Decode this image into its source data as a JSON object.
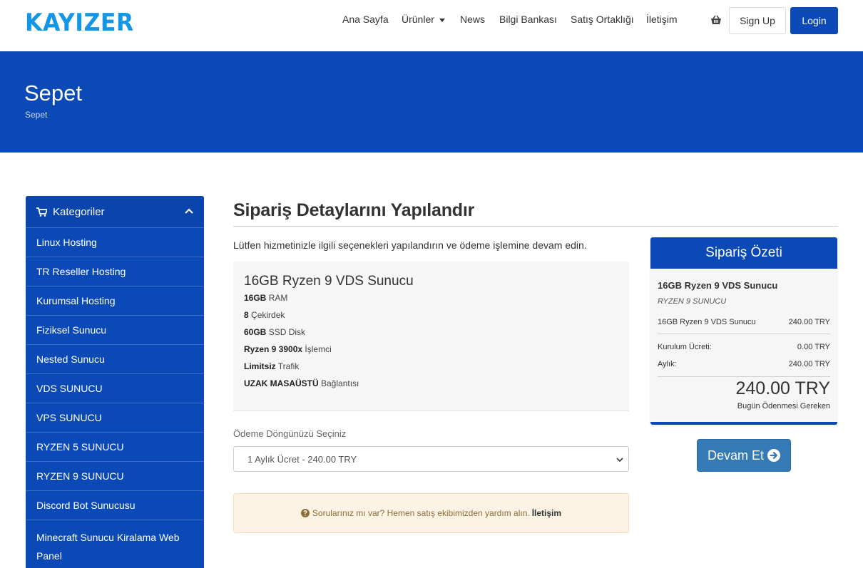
{
  "brand": {
    "logo": "KAYIZER"
  },
  "nav": {
    "items": [
      "Ana Sayfa",
      "Ürünler",
      "News",
      "Bilgi Bankası",
      "Satış Ortaklığı",
      "İletişim"
    ],
    "signup": "Sign Up",
    "login": "Login"
  },
  "hero": {
    "title": "Sepet",
    "breadcrumb": "Sepet"
  },
  "sidebar": {
    "title": "Kategoriler",
    "items": [
      "Linux Hosting",
      "TR Reseller Hosting",
      "Kurumsal Hosting",
      "Fiziksel Sunucu",
      "Nested Sunucu",
      "VDS SUNUCU",
      "VPS SUNUCU",
      "RYZEN 5 SUNUCU",
      "RYZEN 9 SUNUCU",
      "Discord Bot Sunucusu",
      "Minecraft Sunucu Kiralama Web Panel"
    ]
  },
  "main": {
    "title": "Sipariş Detaylarını Yapılandır",
    "intro": "Lütfen hizmetinizle ilgili seçenekleri yapılandırın ve ödeme işlemine devam edin.",
    "product": {
      "name": "16GB Ryzen 9 VDS Sunucu",
      "specs": [
        {
          "bold": "16GB",
          "text": " RAM"
        },
        {
          "bold": "8",
          "text": " Çekirdek"
        },
        {
          "bold": "60GB",
          "text": " SSD Disk"
        },
        {
          "bold": "Ryzen 9 3900x",
          "text": " İşlemci"
        },
        {
          "bold": "Limitsiz",
          "text": " Trafik"
        },
        {
          "bold": "UZAK MASAÜSTÜ",
          "text": " Bağlantısı"
        }
      ]
    },
    "billing": {
      "label": "Ödeme Döngünüzü Seçiniz",
      "selected": "1 Aylık Ücret - 240.00 TRY"
    },
    "help": {
      "text": "Sorularınız mı var? Hemen satış ekibimizden yardım alın.",
      "link": "İletişim"
    }
  },
  "summary": {
    "title": "Sipariş Özeti",
    "product": "16GB Ryzen 9 VDS Sunucu",
    "group": "RYZEN 9 SUNUCU",
    "line_label": "16GB Ryzen 9 VDS Sunucu",
    "line_price": "240.00 TRY",
    "setup_label": "Kurulum Ücreti:",
    "setup_price": "0.00 TRY",
    "monthly_label": "Aylık:",
    "monthly_price": "240.00 TRY",
    "total": "240.00 TRY",
    "total_label": "Bugün Ödenmesi Gereken",
    "continue": "Devam Et"
  },
  "colors": {
    "primary": "#0b4ab6",
    "logo": "#1496e6",
    "button": "#337ab7"
  }
}
